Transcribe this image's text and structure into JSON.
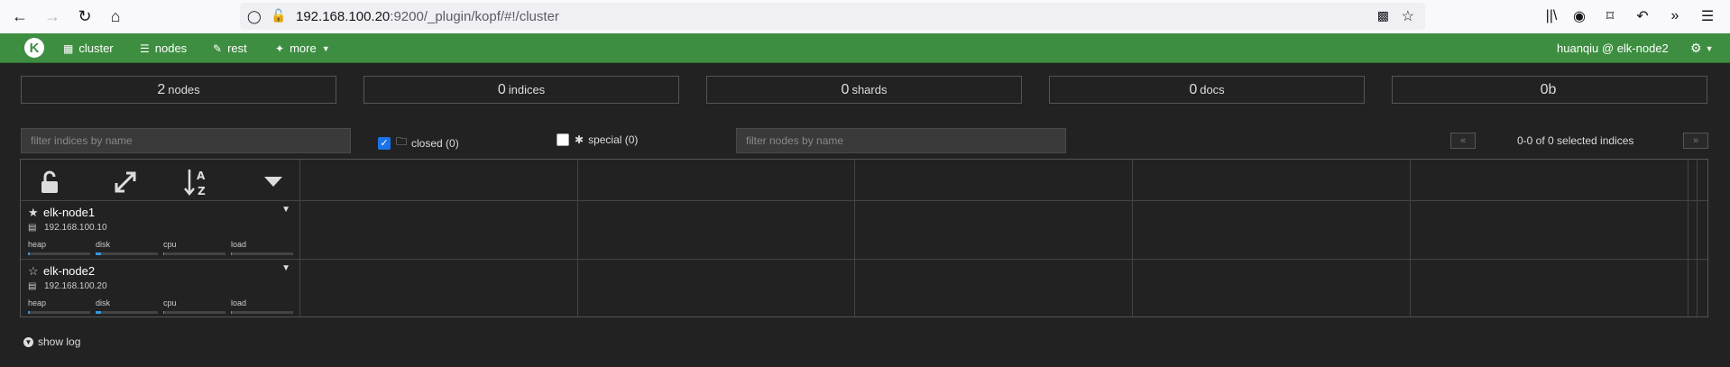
{
  "browser": {
    "url_host": "192.168.100.20",
    "url_rest": ":9200/_plugin/kopf/#!/cluster"
  },
  "navbar": {
    "logo": "K",
    "items": [
      {
        "label": "cluster",
        "icon": "sitemap-icon"
      },
      {
        "label": "nodes",
        "icon": "server-icon"
      },
      {
        "label": "rest",
        "icon": "edit-icon"
      },
      {
        "label": "more",
        "icon": "magic-icon"
      }
    ],
    "user": "huanqiu @ elk-node2"
  },
  "stats": [
    {
      "value": "2",
      "label": "nodes"
    },
    {
      "value": "0",
      "label": "indices"
    },
    {
      "value": "0",
      "label": "shards"
    },
    {
      "value": "0",
      "label": "docs"
    },
    {
      "value": "0b",
      "label": ""
    }
  ],
  "filters": {
    "indices_placeholder": "filter indices by name",
    "closed_label": "closed (0)",
    "closed_checked": true,
    "special_label": "special (0)",
    "special_checked": false,
    "nodes_placeholder": "filter nodes by name",
    "pager_prev": "«",
    "pager_next": "»",
    "pager_text": "0-0 of 0 selected indices"
  },
  "nodes": [
    {
      "name": "elk-node1",
      "master": true,
      "ip": "192.168.100.10",
      "metrics": [
        {
          "label": "heap",
          "fill": 0.03
        },
        {
          "label": "disk",
          "fill": 0.08
        },
        {
          "label": "cpu",
          "fill": 0.02
        },
        {
          "label": "load",
          "fill": 0.01
        }
      ]
    },
    {
      "name": "elk-node2",
      "master": false,
      "ip": "192.168.100.20",
      "metrics": [
        {
          "label": "heap",
          "fill": 0.03
        },
        {
          "label": "disk",
          "fill": 0.08
        },
        {
          "label": "cpu",
          "fill": 0.02
        },
        {
          "label": "load",
          "fill": 0.01
        }
      ]
    }
  ],
  "footer": {
    "show_log": "show log"
  },
  "colors": {
    "navbar": "#3e8e41",
    "background": "#222222",
    "bar_fill": "#3498db"
  }
}
